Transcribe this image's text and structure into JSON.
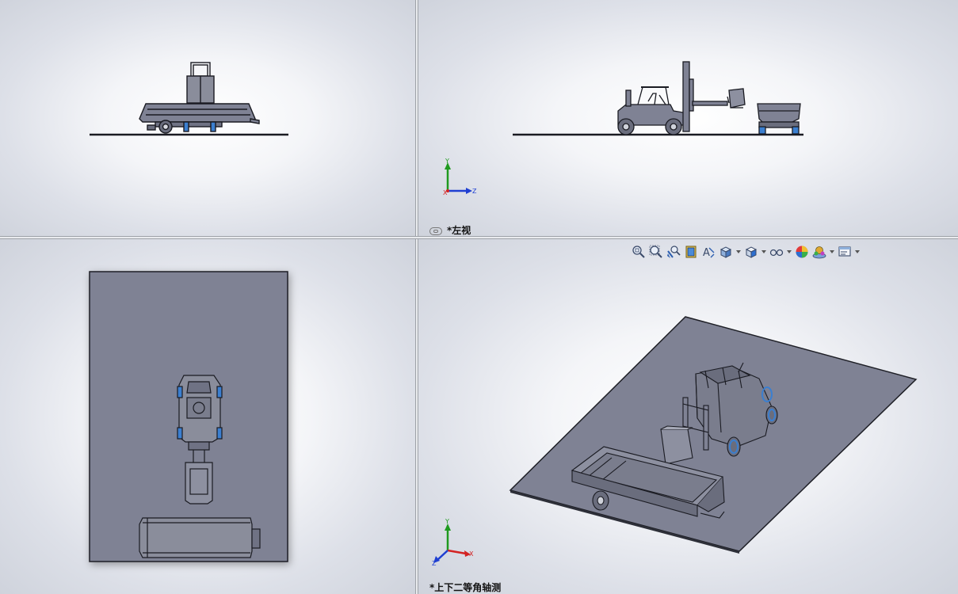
{
  "viewports": {
    "top_right": {
      "label": "*左视"
    },
    "bottom_right": {
      "label": "*上下二等角轴测"
    }
  },
  "triad": {
    "x": "X",
    "y": "Y",
    "z": "Z"
  },
  "heads_up_toolbar": [
    {
      "name": "zoom-to-fit-icon",
      "dropdown": false
    },
    {
      "name": "zoom-to-area-icon",
      "dropdown": false
    },
    {
      "name": "previous-view-icon",
      "dropdown": false
    },
    {
      "name": "section-view-icon",
      "dropdown": false
    },
    {
      "name": "dynamic-annotation-icon",
      "dropdown": false
    },
    {
      "name": "view-orientation-icon",
      "dropdown": true
    },
    {
      "name": "display-style-icon",
      "dropdown": true
    },
    {
      "name": "hide-show-items-icon",
      "dropdown": true
    },
    {
      "name": "edit-appearance-icon",
      "dropdown": false
    },
    {
      "name": "apply-scene-icon",
      "dropdown": true
    },
    {
      "name": "view-settings-icon",
      "dropdown": true
    }
  ],
  "colors": {
    "plate": "#7f8294",
    "plate_edge": "#1e1f26",
    "model_line": "#1a1b22",
    "wheel_accent": "#3b7fd0",
    "axis_x": "#d32323",
    "axis_y": "#1f9a1f",
    "axis_z": "#1f3fd2"
  }
}
